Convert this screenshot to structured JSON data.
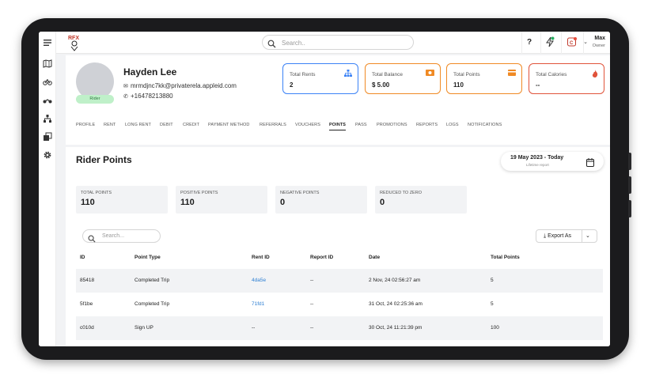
{
  "topbar": {
    "logo_text": "RFX",
    "search_placeholder": "Search..",
    "help_icon": "question-icon",
    "notif_badge": "C",
    "user_name": "Max",
    "user_role": "Owner"
  },
  "profile": {
    "name": "Hayden Lee",
    "email": "mrmdjnc7kk@privaterela.appleid.com",
    "phone": "+16478213880",
    "role_badge": "Rider"
  },
  "stats": [
    {
      "label": "Total Rents",
      "value": "2",
      "color": "#3b82f6",
      "icon": "sitemap-icon"
    },
    {
      "label": "Total Balance",
      "value": "$ 5.00",
      "color": "#f08a24",
      "icon": "money-icon"
    },
    {
      "label": "Total Points",
      "value": "110",
      "color": "#f08a24",
      "icon": "card-icon"
    },
    {
      "label": "Total Calories",
      "value": "--",
      "color": "#e0533a",
      "icon": "flame-icon"
    }
  ],
  "tabs": [
    "PROFILE",
    "RENT",
    "LONG RENT",
    "DEBIT",
    "CREDIT",
    "PAYMENT METHOD",
    "REFERRALS",
    "VOUCHERS",
    "POINTS",
    "PASS",
    "PROMOTIONS",
    "REPORTS",
    "LOGS",
    "NOTIFICATIONS"
  ],
  "active_tab": "POINTS",
  "main": {
    "title": "Rider Points",
    "date_range": "19 May 2023 - Today",
    "date_sub": "Lifetime report",
    "kpis": [
      {
        "label": "TOTAL POINTS",
        "value": "110"
      },
      {
        "label": "POSITIVE POINTS",
        "value": "110"
      },
      {
        "label": "NEGATIVE POINTS",
        "value": "0"
      },
      {
        "label": "REDUCED TO ZERO",
        "value": "0"
      }
    ],
    "search_placeholder": "Search...",
    "export_label": "Export As"
  },
  "table": {
    "columns": [
      "ID",
      "Point Type",
      "Rent ID",
      "Report ID",
      "Date",
      "Total Points"
    ],
    "rows": [
      {
        "id": "85418",
        "type": "Completed Trip",
        "rent_id": "4da5e",
        "report_id": "--",
        "date": "2 Nov, 24 02:56:27 am",
        "points": "5"
      },
      {
        "id": "5f1be",
        "type": "Completed Trip",
        "rent_id": "71fd1",
        "report_id": "--",
        "date": "31 Oct, 24 02:25:36 am",
        "points": "5"
      },
      {
        "id": "c010d",
        "type": "Sign UP",
        "rent_id": "--",
        "report_id": "--",
        "date": "30 Oct, 24 11:21:39 pm",
        "points": "100"
      }
    ]
  },
  "colors": {
    "link": "#2d7fd3",
    "rider_badge_bg": "#bff0c9"
  }
}
